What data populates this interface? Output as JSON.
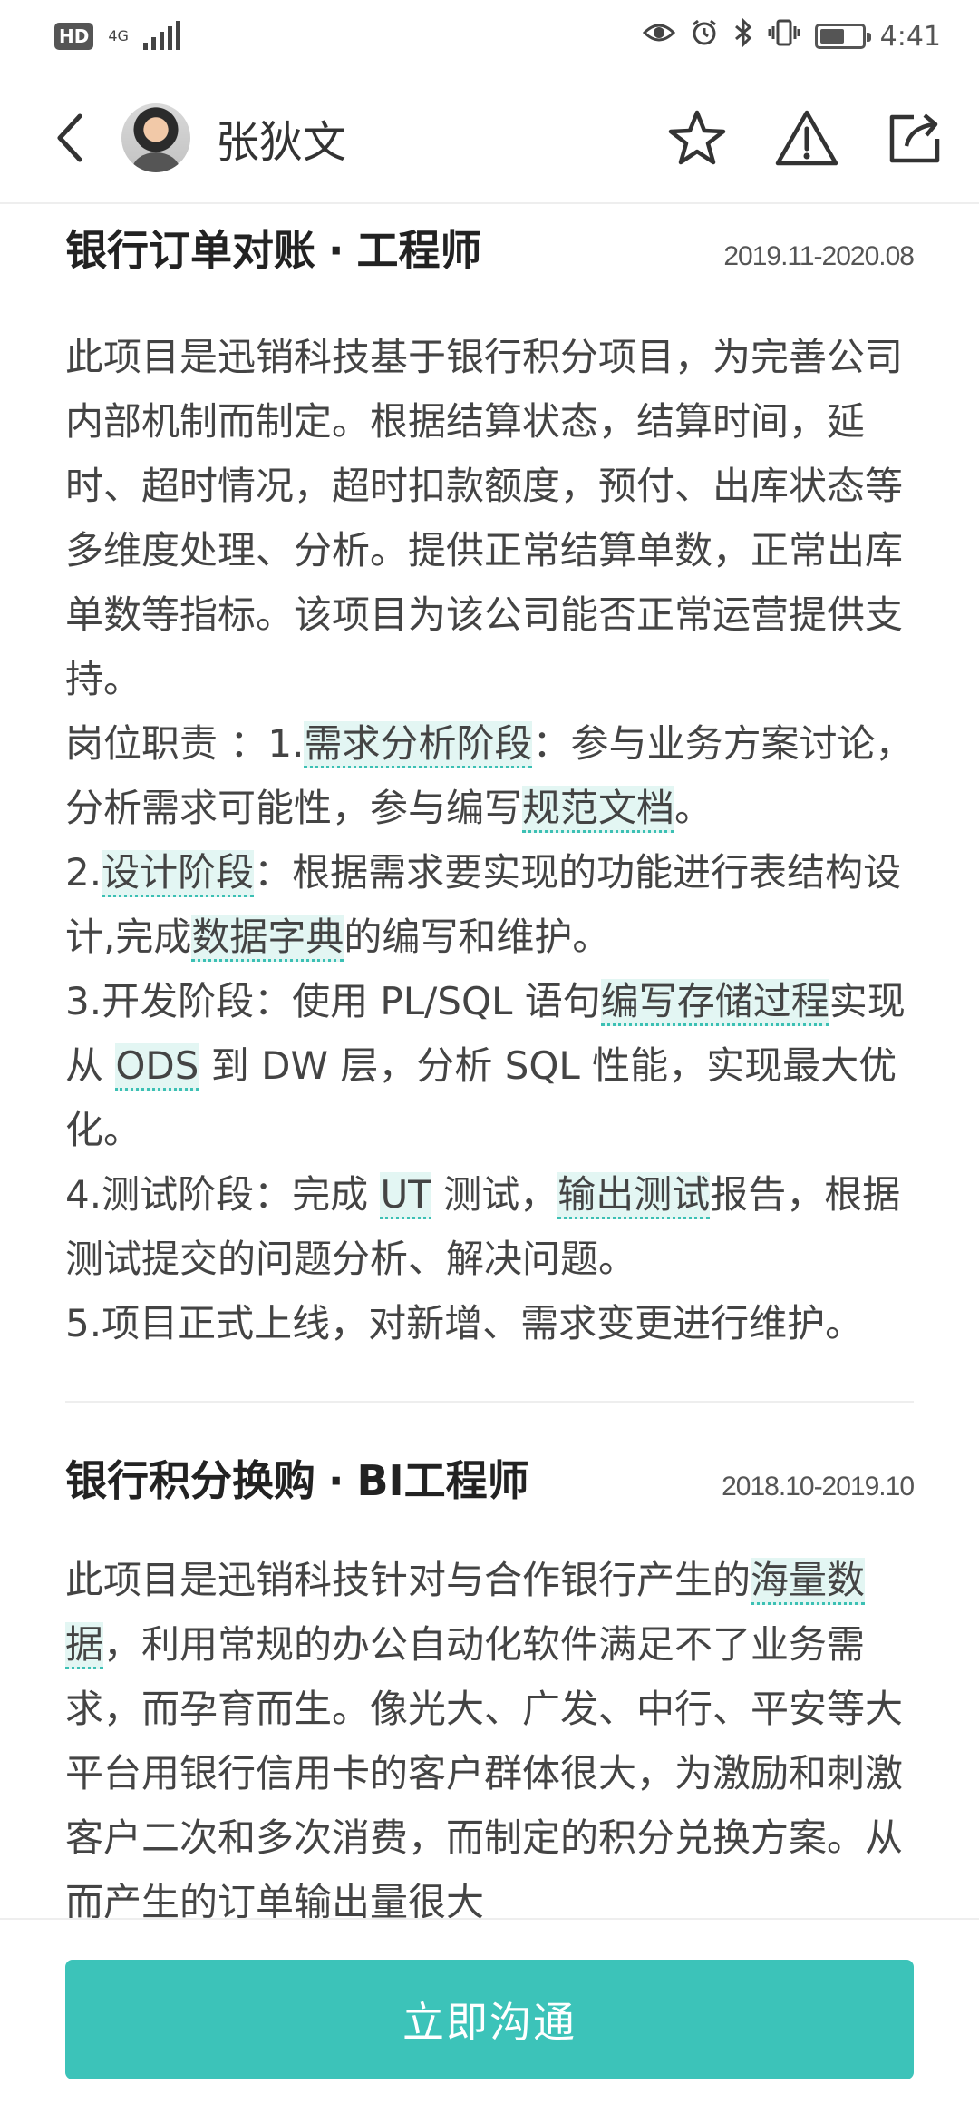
{
  "status_bar": {
    "hd": "HD",
    "network": "4G",
    "time": "4:41"
  },
  "header": {
    "contact_name": "张狄文"
  },
  "projects": [
    {
      "title": "银行订单对账",
      "separator": "·",
      "role": "工程师",
      "period": "2019.11-2020.08",
      "segments": [
        {
          "t": "此项目是迅销科技基于银行积分项目，为完善公司内部机制而制定。根据结算状态，结算时间，延时、超时情况，超时扣款额度，预付、出库状态等多维度处理、分析。提供正常结算单数，正常出库单数等指标。该项目为该公司能否正常运营提供支持。"
        },
        {
          "br": true
        },
        {
          "t": "岗位职责 ：1."
        },
        {
          "k": "需求分析阶段"
        },
        {
          "t": "：参与业务方案讨论，分析需求可能性，参与编写"
        },
        {
          "k": "规范文档"
        },
        {
          "t": "。"
        },
        {
          "br": true
        },
        {
          "t": "2."
        },
        {
          "k": "设计阶段"
        },
        {
          "t": "：根据需求要实现的功能进行表结构设计,完成"
        },
        {
          "k": "数据字典"
        },
        {
          "t": "的编写和维护。"
        },
        {
          "br": true
        },
        {
          "t": "3.开发阶段：使用 PL/SQL 语句"
        },
        {
          "k": "编写存储过程"
        },
        {
          "t": "实现从 "
        },
        {
          "k": "ODS"
        },
        {
          "t": " 到 DW 层，分析 SQL 性能，实现最大优化。"
        },
        {
          "br": true
        },
        {
          "t": "4.测试阶段：完成 "
        },
        {
          "k": "UT"
        },
        {
          "t": " 测试，"
        },
        {
          "k": "输出测试"
        },
        {
          "t": "报告，根据测试提交的问题分析、解决问题。"
        },
        {
          "br": true
        },
        {
          "t": "5.项目正式上线，对新增、需求变更进行维护。"
        }
      ]
    },
    {
      "title": "银行积分换购",
      "separator": "·",
      "role": "BI工程师",
      "period": "2018.10-2019.10",
      "segments": [
        {
          "t": "此项目是迅销科技针对与合作银行产生的"
        },
        {
          "k": "海量数据"
        },
        {
          "t": "，利用常规的办公自动化软件满足不了业务需求，而孕育而生。像光大、广发、中行、平安等大平台用银行信用卡的客户群体很大，为激励和刺激客户二次和多次消费，而制定的积分兑换方案。从而产生的订单输出量很大"
        }
      ]
    }
  ],
  "footer": {
    "cta_label": "立即沟通"
  },
  "colors": {
    "accent": "#3cc3b9",
    "keyword_bg": "#e3f6f3",
    "keyword_underline": "#3cc0b4"
  },
  "icons": [
    "back-arrow-icon",
    "star-icon",
    "warning-icon",
    "share-icon",
    "eye-icon",
    "alarm-icon",
    "bluetooth-icon",
    "vibrate-icon",
    "battery-icon",
    "signal-icon"
  ]
}
